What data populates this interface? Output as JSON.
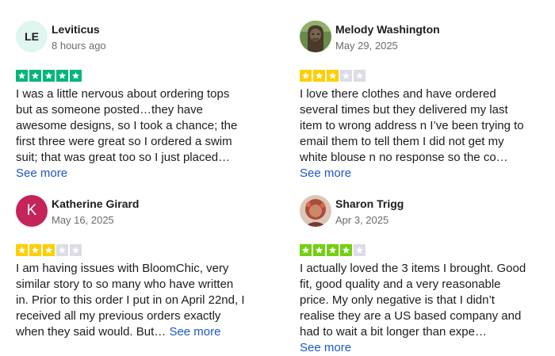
{
  "reviews": [
    {
      "name": "Leviticus",
      "date": "8 hours ago",
      "avatar": {
        "type": "initials",
        "text": "LE",
        "bg": "#dff5f0"
      },
      "rating": 5,
      "star_color": "#00b67a",
      "lines": [
        "I was a little nervous about ordering tops",
        "but as someone posted…they have",
        "awesome designs, so I took a chance; the",
        "first three were great so I ordered a swim",
        "suit; that was great too so I just placed…"
      ],
      "see_more": "See more"
    },
    {
      "name": "Melody Washington",
      "date": "May 29, 2025",
      "avatar": {
        "type": "photo",
        "icon": "profile-photo-icon"
      },
      "rating": 3,
      "star_color": "#ffce00",
      "lines": [
        "I love there clothes and have ordered",
        "several times but they delivered my last",
        "item to wrong address n I’ve been trying to",
        "email them to tell them I did not get my",
        "white blouse n no response so the co…"
      ],
      "see_more": "See more"
    },
    {
      "name": "Katherine Girard",
      "date": "May 16, 2025",
      "avatar": {
        "type": "letter",
        "text": "K",
        "bg": "#c5245a"
      },
      "rating": 3,
      "star_color": "#ffce00",
      "lines": [
        "I am having issues with BloomChic, very",
        "similar story to so many who have written",
        "in. Prior to this order I put in on April 22nd, I",
        "received all my previous orders exactly",
        "when they said would. But…"
      ],
      "see_more": "See more"
    },
    {
      "name": "Sharon Trigg",
      "date": "Apr 3, 2025",
      "avatar": {
        "type": "photo",
        "icon": "profile-photo-icon"
      },
      "rating": 4,
      "star_color": "#73cf11",
      "lines": [
        "I actually loved the 3 items I brought. Good",
        "fit, good quality and a very reasonable",
        "price. My only negative is that I didn’t",
        "realise they are a US based company and",
        "had to wait a bit longer than expe…"
      ],
      "see_more": "See more"
    }
  ],
  "empty_star_color": "#dcdce6"
}
